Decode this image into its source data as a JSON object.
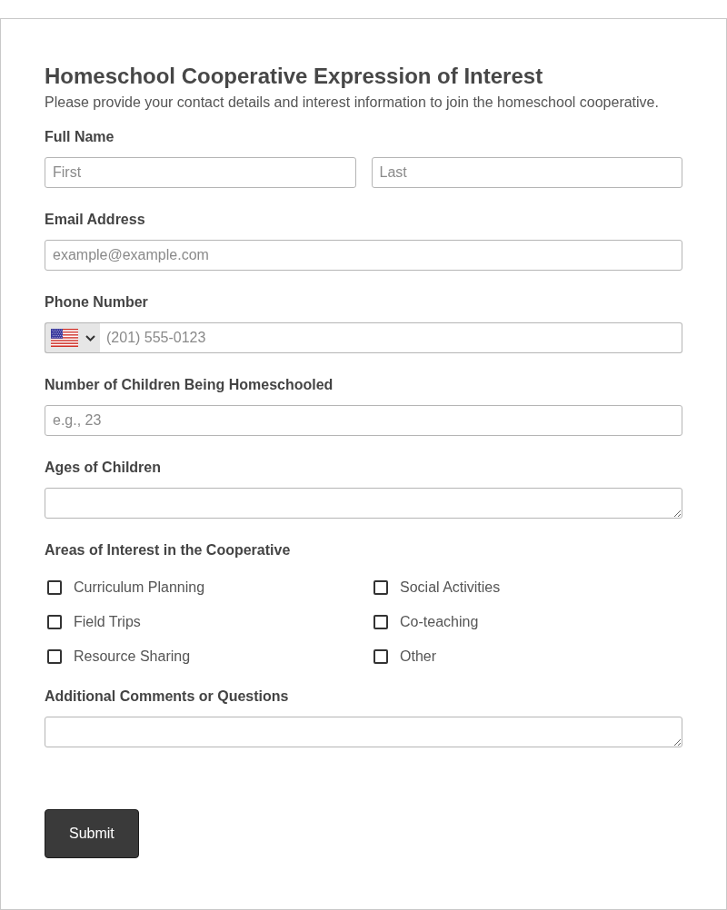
{
  "form": {
    "title": "Homeschool Cooperative Expression of Interest",
    "description": "Please provide your contact details and interest information to join the homeschool cooperative.",
    "fields": [
      {
        "kind": "name",
        "label": "Full Name",
        "inputs": [
          {
            "placeholder": "First"
          },
          {
            "placeholder": "Last"
          }
        ]
      },
      {
        "kind": "text",
        "label": "Email Address",
        "placeholder": "example@example.com"
      },
      {
        "kind": "phone",
        "label": "Phone Number",
        "placeholder": "(201) 555-0123"
      },
      {
        "kind": "text",
        "label": "Number of Children Being Homeschooled",
        "placeholder": "e.g., 23"
      },
      {
        "kind": "textarea",
        "label": "Ages of Children"
      },
      {
        "kind": "checkboxes",
        "label": "Areas of Interest in the Cooperative",
        "options": [
          {
            "label": "Curriculum Planning",
            "checked": false
          },
          {
            "label": "Field Trips",
            "checked": false
          },
          {
            "label": "Resource Sharing",
            "checked": false
          },
          {
            "label": "Social Activities",
            "checked": false
          },
          {
            "label": "Co-teaching",
            "checked": false
          },
          {
            "label": "Other",
            "checked": false
          }
        ]
      },
      {
        "kind": "textarea",
        "label": "Additional Comments or Questions"
      }
    ],
    "submit": "Submit"
  }
}
